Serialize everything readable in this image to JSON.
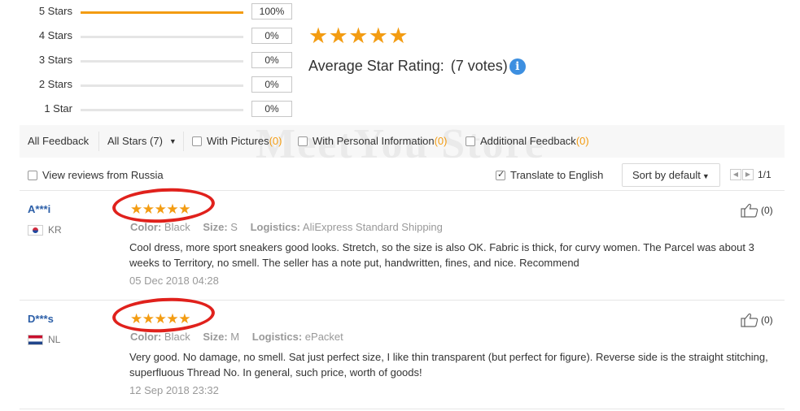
{
  "histogram": [
    {
      "label": "5 Stars",
      "percent": "100%",
      "fill": 1.0
    },
    {
      "label": "4 Stars",
      "percent": "0%",
      "fill": 0
    },
    {
      "label": "3 Stars",
      "percent": "0%",
      "fill": 0
    },
    {
      "label": "2 Stars",
      "percent": "0%",
      "fill": 0
    },
    {
      "label": "1 Star",
      "percent": "0%",
      "fill": 0
    }
  ],
  "average": {
    "stars": 5,
    "label": "Average Star Rating:",
    "votes": "(7 votes)",
    "info_glyph": "i"
  },
  "watermark": "MeetYou Store",
  "filters": {
    "all_feedback": "All Feedback",
    "all_stars": "All Stars (7)",
    "with_pictures": "With Pictures",
    "with_pictures_count": "(0)",
    "with_personal": "With Personal Information",
    "with_personal_count": "(0)",
    "additional": "Additional Feedback",
    "additional_count": "(0)"
  },
  "options": {
    "view_russia": "View reviews from Russia",
    "translate": "Translate to English",
    "translate_checked": true,
    "sort": "Sort by default",
    "page": "1/1"
  },
  "reviews": [
    {
      "name": "A***i",
      "country": "KR",
      "flag": "kr",
      "stars": 5,
      "color_label": "Color:",
      "color": "Black",
      "size_label": "Size:",
      "size": "S",
      "logistics_label": "Logistics:",
      "logistics": "AliExpress Standard Shipping",
      "text": "Cool dress, more sport sneakers good looks. Stretch, so the size is also OK. Fabric is thick, for curvy women. The Parcel was about 3 weeks to Territory, no smell. The seller has a note put, handwritten, fines, and nice. Recommend",
      "date": "05 Dec 2018 04:28",
      "helpful": "(0)"
    },
    {
      "name": "D***s",
      "country": "NL",
      "flag": "nl",
      "stars": 5,
      "color_label": "Color:",
      "color": "Black",
      "size_label": "Size:",
      "size": "M",
      "logistics_label": "Logistics:",
      "logistics": "ePacket",
      "text": "Very good. No damage, no smell. Sat just perfect size, I like thin transparent (but perfect for figure). Reverse side is the straight stitching, superfluous Thread No. In general, such price, worth of goods!",
      "date": "12 Sep 2018 23:32",
      "helpful": "(0)"
    }
  ],
  "colors": {
    "star": "#f39c12",
    "accent_blue": "#2b5ea7",
    "annotation_red": "#e0211c",
    "info_blue": "#3d8fe0"
  },
  "icons": {
    "star": "star-icon",
    "info": "info-icon",
    "thumb": "thumbs-up-icon",
    "caret": "chevron-down-icon"
  }
}
